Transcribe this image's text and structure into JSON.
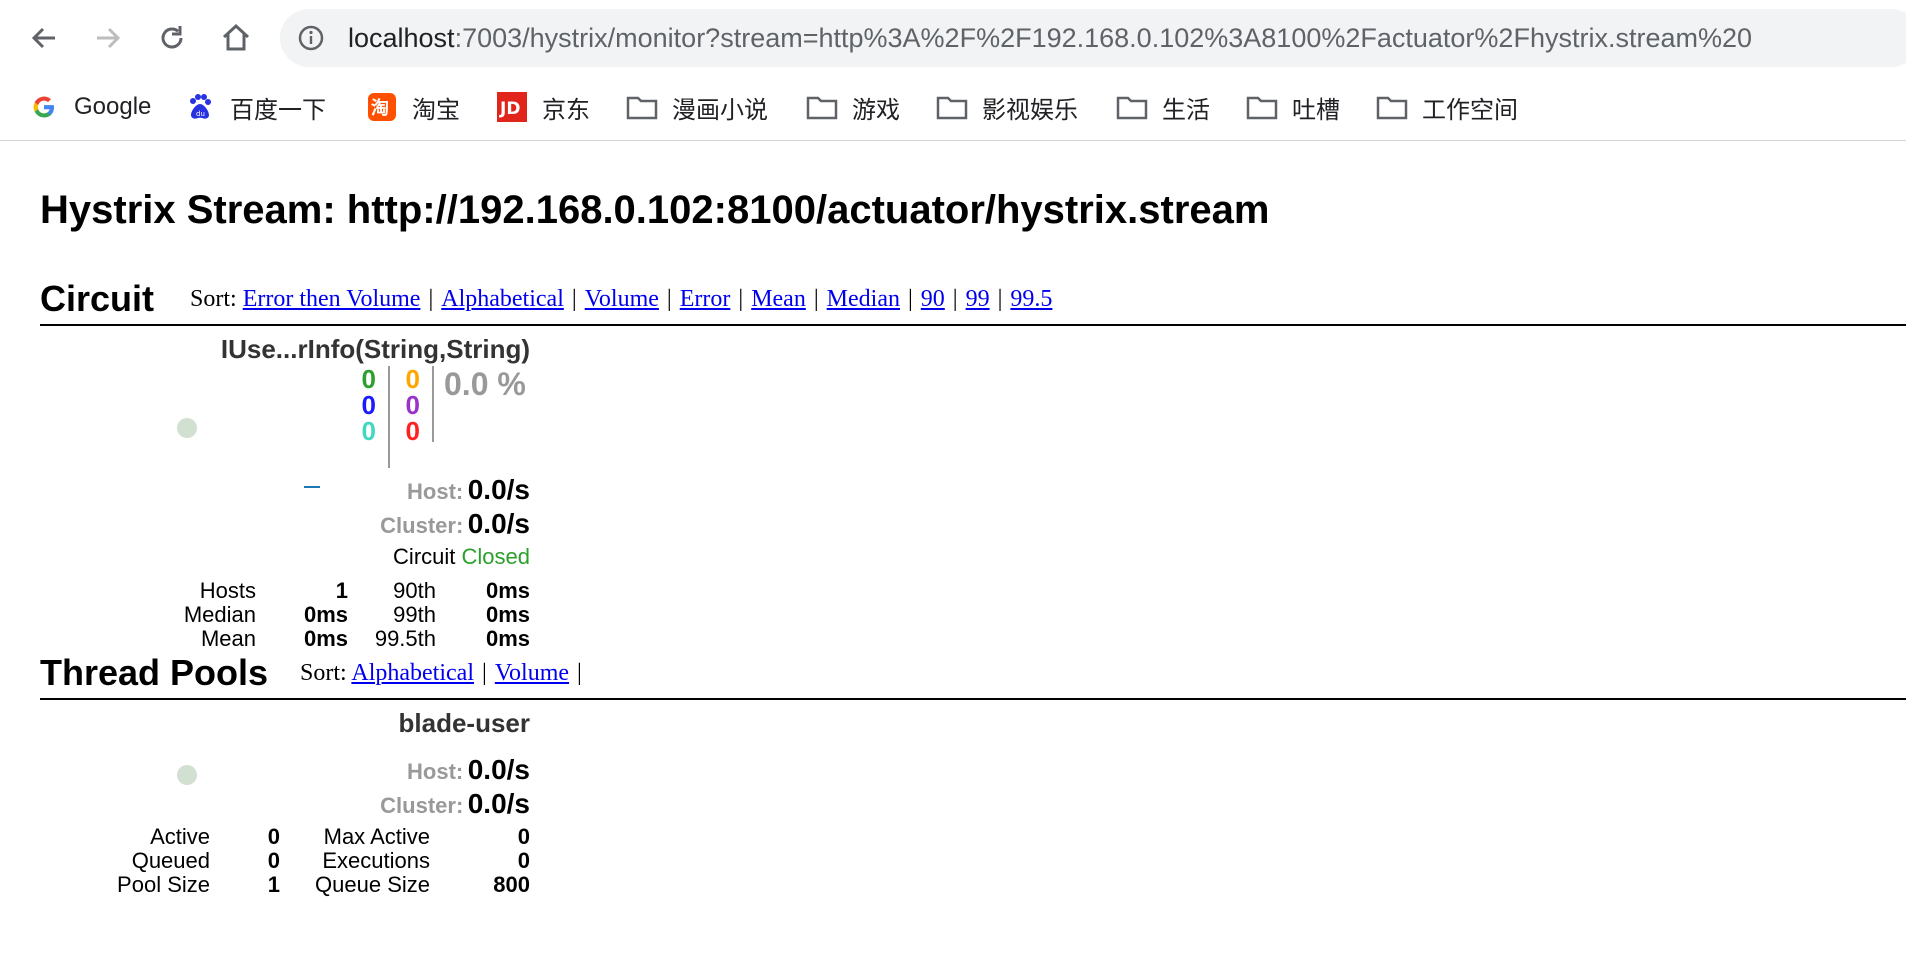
{
  "browser": {
    "url_host": "localhost",
    "url_rest": ":7003/hystrix/monitor?stream=http%3A%2F%2F192.168.0.102%3A8100%2Factuator%2Fhystrix.stream%20",
    "bookmarks": [
      {
        "label": "Google",
        "icon": "google-icon"
      },
      {
        "label": "百度一下",
        "icon": "baidu-icon"
      },
      {
        "label": "淘宝",
        "icon": "taobao-icon"
      },
      {
        "label": "京东",
        "icon": "jd-icon"
      },
      {
        "label": "漫画小说",
        "icon": "folder-icon"
      },
      {
        "label": "游戏",
        "icon": "folder-icon"
      },
      {
        "label": "影视娱乐",
        "icon": "folder-icon"
      },
      {
        "label": "生活",
        "icon": "folder-icon"
      },
      {
        "label": "吐槽",
        "icon": "folder-icon"
      },
      {
        "label": "工作空间",
        "icon": "folder-icon"
      }
    ]
  },
  "page": {
    "title": "Hystrix Stream: http://192.168.0.102:8100/actuator/hystrix.stream"
  },
  "circuit": {
    "heading": "Circuit",
    "sort_label": "Sort:",
    "sort_links": [
      "Error then Volume",
      "Alphabetical",
      "Volume",
      "Error",
      "Mean",
      "Median",
      "90",
      "99",
      "99.5"
    ],
    "item": {
      "name": "IUse...rInfo(String,String)",
      "counts_left": [
        "0",
        "0",
        "0"
      ],
      "counts_right": [
        "0",
        "0",
        "0"
      ],
      "error_pct": "0.0 %",
      "host_label": "Host:",
      "host_rate": "0.0/s",
      "cluster_label": "Cluster:",
      "cluster_rate": "0.0/s",
      "circuit_label": "Circuit",
      "circuit_status": "Closed",
      "stats": {
        "hosts_label": "Hosts",
        "hosts": "1",
        "median_label": "Median",
        "median": "0ms",
        "mean_label": "Mean",
        "mean": "0ms",
        "p90_label": "90th",
        "p90": "0ms",
        "p99_label": "99th",
        "p99": "0ms",
        "p995_label": "99.5th",
        "p995": "0ms"
      }
    }
  },
  "thread_pools": {
    "heading": "Thread Pools",
    "sort_label": "Sort:",
    "sort_links": [
      "Alphabetical",
      "Volume"
    ],
    "item": {
      "name": "blade-user",
      "host_label": "Host:",
      "host_rate": "0.0/s",
      "cluster_label": "Cluster:",
      "cluster_rate": "0.0/s",
      "stats": {
        "active_label": "Active",
        "active": "0",
        "queued_label": "Queued",
        "queued": "0",
        "pool_size_label": "Pool Size",
        "pool_size": "1",
        "max_active_label": "Max Active",
        "max_active": "0",
        "executions_label": "Executions",
        "executions": "0",
        "queue_size_label": "Queue Size",
        "queue_size": "800"
      }
    }
  },
  "colors": {
    "success": "#2ca02c",
    "short_circuited": "#1a1aff",
    "bad_request": "#40d8c0",
    "timeout": "#ffa500",
    "rejected": "#9933cc",
    "failure": "#ff2020",
    "error_pct": "#999999",
    "closed": "#2ca02c",
    "link": "#0000ee"
  }
}
